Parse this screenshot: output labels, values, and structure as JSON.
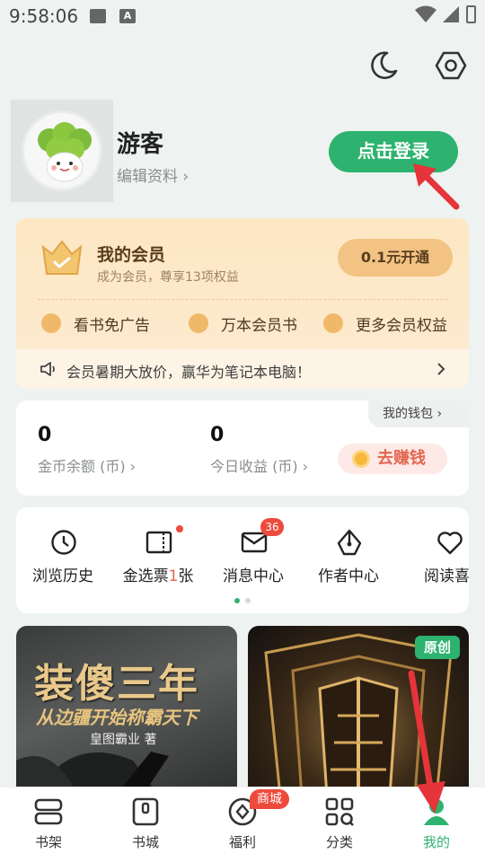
{
  "status_bar": {
    "time": "9:58:06",
    "a_icon_label": "A"
  },
  "profile": {
    "username": "游客",
    "edit_label": "编辑资料 ›",
    "login_label": "点击登录"
  },
  "member": {
    "title": "我的会员",
    "subtitle": "成为会员，尊享13项权益",
    "open_label": "0.1元开通",
    "perks": [
      {
        "icon": "ad-icon",
        "label": "看书免广告"
      },
      {
        "icon": "book-icon",
        "label": "万本会员书"
      },
      {
        "icon": "more-icon",
        "label": "更多会员权益"
      }
    ],
    "announcement": "会员暑期大放价，赢华为笔记本电脑！"
  },
  "wallet": {
    "tab_label": "我的钱包 ›",
    "coin_value": "0",
    "coin_label": "金币余额 (币) ›",
    "income_value": "0",
    "income_label": "今日收益 (币) ›",
    "earn_label": "去赚钱"
  },
  "quick_entries": [
    {
      "icon": "clock-icon",
      "label": "浏览历史"
    },
    {
      "icon": "ticket-icon",
      "label_prefix": "金选票",
      "label_count": "1",
      "label_suffix": "张"
    },
    {
      "icon": "message-icon",
      "label": "消息中心",
      "badge": "36"
    },
    {
      "icon": "pen-icon",
      "label": "作者中心"
    },
    {
      "icon": "heart-icon",
      "label": "阅读喜"
    }
  ],
  "books": [
    {
      "title": "装傻三年",
      "subtitle": "从边疆开始称霸天下",
      "author": "皇图霸业 著"
    },
    {
      "badge": "原创"
    }
  ],
  "bottom_nav": [
    {
      "icon": "bookshelf-icon",
      "label": "书架"
    },
    {
      "icon": "bookstore-icon",
      "label": "书城"
    },
    {
      "icon": "welfare-icon",
      "label": "福利",
      "badge": "商城"
    },
    {
      "icon": "category-icon",
      "label": "分类"
    },
    {
      "icon": "profile-icon",
      "label": "我的",
      "active": true
    }
  ],
  "colors": {
    "accent": "#2db36f",
    "badge_red": "#ee4a3c",
    "member_gold": "#f2c383",
    "annotation_arrow": "#e5343a"
  }
}
